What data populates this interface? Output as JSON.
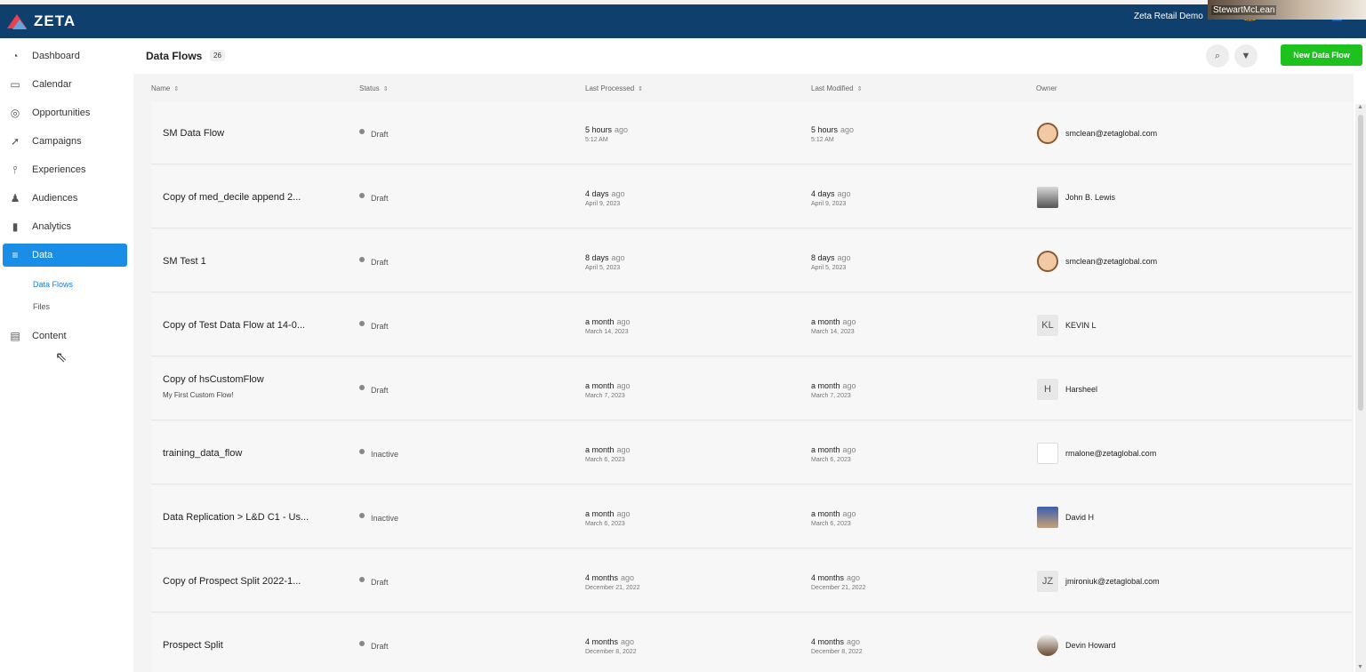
{
  "app": {
    "logo_text": "ZETA",
    "account_name": "Zeta Retail Demo",
    "webcam_name": "StewartMcLean"
  },
  "sidebar": {
    "items": [
      {
        "label": "Dashboard",
        "icon": "dashboard-icon",
        "glyph": "◔"
      },
      {
        "label": "Calendar",
        "icon": "calendar-icon",
        "glyph": "▭"
      },
      {
        "label": "Opportunities",
        "icon": "target-icon",
        "glyph": "◎"
      },
      {
        "label": "Campaigns",
        "icon": "paper-plane-icon",
        "glyph": "➚"
      },
      {
        "label": "Experiences",
        "icon": "hierarchy-icon",
        "glyph": "⫯"
      },
      {
        "label": "Audiences",
        "icon": "people-icon",
        "glyph": "♟"
      },
      {
        "label": "Analytics",
        "icon": "bar-chart-icon",
        "glyph": "▮"
      },
      {
        "label": "Data",
        "icon": "database-icon",
        "glyph": "≡"
      }
    ],
    "sub_items": [
      {
        "label": "Data Flows"
      },
      {
        "label": "Files"
      }
    ],
    "content": {
      "label": "Content",
      "icon": "pages-icon",
      "glyph": "▤"
    }
  },
  "header": {
    "title": "Data Flows",
    "count": "26",
    "new_button": "New Data Flow"
  },
  "table": {
    "columns": [
      "Name",
      "Status",
      "Last Processed",
      "Last Modified",
      "Owner"
    ],
    "rows": [
      {
        "name": "SM Data Flow",
        "desc": "",
        "status": "Draft",
        "processed": "5 hours",
        "processed_sub": "5:12 AM",
        "modified": "5 hours",
        "modified_sub": "5:12 AM",
        "owner": "smclean@zetaglobal.com",
        "avatar": "face",
        "initials": ""
      },
      {
        "name": "Copy of med_decile append 2...",
        "desc": "",
        "status": "Draft",
        "processed": "4 days",
        "processed_sub": "April 9, 2023",
        "modified": "4 days",
        "modified_sub": "April 9, 2023",
        "owner": "John B. Lewis",
        "avatar": "photo",
        "initials": ""
      },
      {
        "name": "SM Test 1",
        "desc": "",
        "status": "Draft",
        "processed": "8 days",
        "processed_sub": "April 5, 2023",
        "modified": "8 days",
        "modified_sub": "April 5, 2023",
        "owner": "smclean@zetaglobal.com",
        "avatar": "face",
        "initials": ""
      },
      {
        "name": "Copy of Test Data Flow at 14-0...",
        "desc": "",
        "status": "Draft",
        "processed": "a month",
        "processed_sub": "March 14, 2023",
        "modified": "a month",
        "modified_sub": "March 14, 2023",
        "owner": "KEVIN L",
        "avatar": "initials",
        "initials": "KL"
      },
      {
        "name": "Copy of hsCustomFlow",
        "desc": "My First Custom Flow!",
        "status": "Draft",
        "processed": "a month",
        "processed_sub": "March 7, 2023",
        "modified": "a month",
        "modified_sub": "March 7, 2023",
        "owner": "Harsheel",
        "avatar": "initials",
        "initials": "H"
      },
      {
        "name": "training_data_flow",
        "desc": "",
        "status": "Inactive",
        "processed": "a month",
        "processed_sub": "March 6, 2023",
        "modified": "a month",
        "modified_sub": "March 6, 2023",
        "owner": "rmalone@zetaglobal.com",
        "avatar": "blank",
        "initials": ""
      },
      {
        "name": "Data Replication > L&D C1 - Us...",
        "desc": "",
        "status": "Inactive",
        "processed": "a month",
        "processed_sub": "March 6, 2023",
        "modified": "a month",
        "modified_sub": "March 6, 2023",
        "owner": "David H",
        "avatar": "blue",
        "initials": ""
      },
      {
        "name": "Copy of Prospect Split 2022-1...",
        "desc": "",
        "status": "Draft",
        "processed": "4 months",
        "processed_sub": "December 21, 2022",
        "modified": "4 months",
        "modified_sub": "December 21, 2022",
        "owner": "jmironiuk@zetaglobal.com",
        "avatar": "initials",
        "initials": "JZ"
      },
      {
        "name": "Prospect Split",
        "desc": "",
        "status": "Draft",
        "processed": "4 months",
        "processed_sub": "December 8, 2022",
        "modified": "4 months",
        "modified_sub": "December 8, 2022",
        "owner": "Devin Howard",
        "avatar": "dark",
        "initials": ""
      }
    ],
    "ago_suffix": "ago"
  },
  "colors": {
    "topbar": "#0f3f6d",
    "accent": "#1a8de6",
    "new_button": "#1ec21e"
  }
}
